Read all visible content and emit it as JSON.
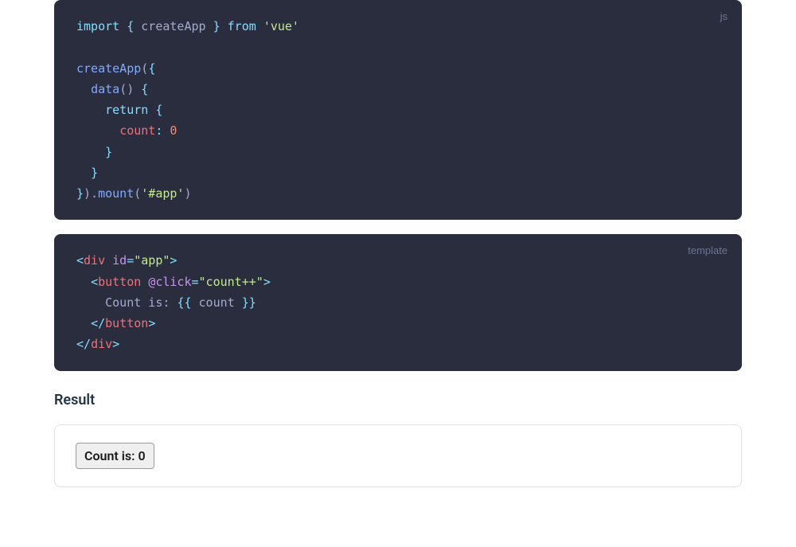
{
  "code1": {
    "label": "js",
    "tokens": [
      [
        {
          "t": "import",
          "c": "tok-import"
        },
        {
          "t": " { ",
          "c": "tok-brace"
        },
        {
          "t": "createApp",
          "c": "tok-plain"
        },
        {
          "t": " } ",
          "c": "tok-brace"
        },
        {
          "t": "from",
          "c": "tok-import"
        },
        {
          "t": " ",
          "c": "tok-plain"
        },
        {
          "t": "'vue'",
          "c": "tok-string"
        }
      ],
      [],
      [
        {
          "t": "createApp",
          "c": "tok-func"
        },
        {
          "t": "(",
          "c": "tok-plain"
        },
        {
          "t": "{",
          "c": "tok-brace"
        }
      ],
      [
        {
          "t": "  ",
          "c": "tok-plain"
        },
        {
          "t": "data",
          "c": "tok-func"
        },
        {
          "t": "() ",
          "c": "tok-plain"
        },
        {
          "t": "{",
          "c": "tok-brace"
        }
      ],
      [
        {
          "t": "    ",
          "c": "tok-plain"
        },
        {
          "t": "return",
          "c": "tok-import"
        },
        {
          "t": " ",
          "c": "tok-plain"
        },
        {
          "t": "{",
          "c": "tok-brace"
        }
      ],
      [
        {
          "t": "      ",
          "c": "tok-plain"
        },
        {
          "t": "count",
          "c": "tok-prop"
        },
        {
          "t": ":",
          "c": "tok-operator"
        },
        {
          "t": " ",
          "c": "tok-plain"
        },
        {
          "t": "0",
          "c": "tok-number"
        }
      ],
      [
        {
          "t": "    ",
          "c": "tok-plain"
        },
        {
          "t": "}",
          "c": "tok-brace"
        }
      ],
      [
        {
          "t": "  ",
          "c": "tok-plain"
        },
        {
          "t": "}",
          "c": "tok-brace"
        }
      ],
      [
        {
          "t": "}",
          "c": "tok-brace"
        },
        {
          "t": ").",
          "c": "tok-plain"
        },
        {
          "t": "mount",
          "c": "tok-func"
        },
        {
          "t": "(",
          "c": "tok-plain"
        },
        {
          "t": "'#app'",
          "c": "tok-string"
        },
        {
          "t": ")",
          "c": "tok-plain"
        }
      ]
    ]
  },
  "code2": {
    "label": "template",
    "tokens": [
      [
        {
          "t": "<",
          "c": "tok-angle"
        },
        {
          "t": "div",
          "c": "tok-tag"
        },
        {
          "t": " ",
          "c": "tok-plain"
        },
        {
          "t": "id",
          "c": "tok-attr"
        },
        {
          "t": "=",
          "c": "tok-angle"
        },
        {
          "t": "\"app\"",
          "c": "tok-attrval"
        },
        {
          "t": ">",
          "c": "tok-angle"
        }
      ],
      [
        {
          "t": "  ",
          "c": "tok-plain"
        },
        {
          "t": "<",
          "c": "tok-angle"
        },
        {
          "t": "button",
          "c": "tok-tag"
        },
        {
          "t": " ",
          "c": "tok-plain"
        },
        {
          "t": "@click",
          "c": "tok-attr"
        },
        {
          "t": "=",
          "c": "tok-angle"
        },
        {
          "t": "\"count++\"",
          "c": "tok-attrval"
        },
        {
          "t": ">",
          "c": "tok-angle"
        }
      ],
      [
        {
          "t": "    Count is: ",
          "c": "tok-text"
        },
        {
          "t": "{{",
          "c": "tok-brace"
        },
        {
          "t": " count ",
          "c": "tok-text"
        },
        {
          "t": "}}",
          "c": "tok-brace"
        }
      ],
      [
        {
          "t": "  ",
          "c": "tok-plain"
        },
        {
          "t": "</",
          "c": "tok-angle"
        },
        {
          "t": "button",
          "c": "tok-tag"
        },
        {
          "t": ">",
          "c": "tok-angle"
        }
      ],
      [
        {
          "t": "</",
          "c": "tok-angle"
        },
        {
          "t": "div",
          "c": "tok-tag"
        },
        {
          "t": ">",
          "c": "tok-angle"
        }
      ]
    ]
  },
  "result": {
    "heading": "Result",
    "button_label": "Count is: 0"
  }
}
